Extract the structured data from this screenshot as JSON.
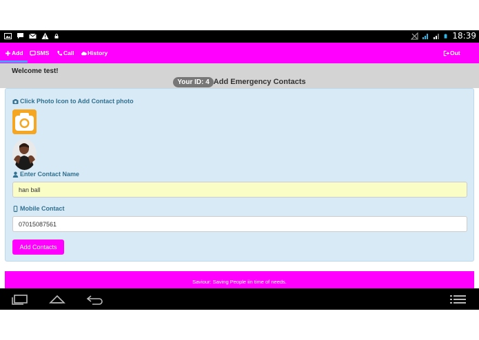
{
  "status_bar": {
    "time": "18:39",
    "left_icons": [
      "image-icon",
      "chat-icon",
      "mail-icon",
      "warning-icon",
      "lock-icon"
    ],
    "right_icons": [
      "signal-off-icon",
      "wifi-signal-icon",
      "cell-signal-icon",
      "battery-icon"
    ]
  },
  "nav": {
    "items": [
      {
        "label": "Add",
        "icon": "plus-icon"
      },
      {
        "label": "SMS",
        "icon": "sms-icon"
      },
      {
        "label": "Call",
        "icon": "phone-icon"
      },
      {
        "label": "History",
        "icon": "cloud-icon"
      }
    ],
    "logout_label": "Out",
    "logout_icon": "logout-icon",
    "accent": "#ff00ff"
  },
  "header": {
    "welcome": "Welcome test!",
    "id_badge": "Your ID: 4",
    "title": "Add Emergency Contacts"
  },
  "form": {
    "photo_label": "Click Photo Icon to Add Contact photo",
    "name_label": "Enter Contact Name",
    "name_value": "han ball",
    "mobile_label": "Mobile Contact",
    "mobile_value": "07015087561",
    "submit_label": "Add Contacts"
  },
  "footer": {
    "text": "Saviour: Saving People iin time of needs."
  },
  "colors": {
    "brand": "#ff00ff",
    "panel_bg": "#d9eaf7",
    "label": "#31708f",
    "highlight_input": "#fafdc6"
  }
}
